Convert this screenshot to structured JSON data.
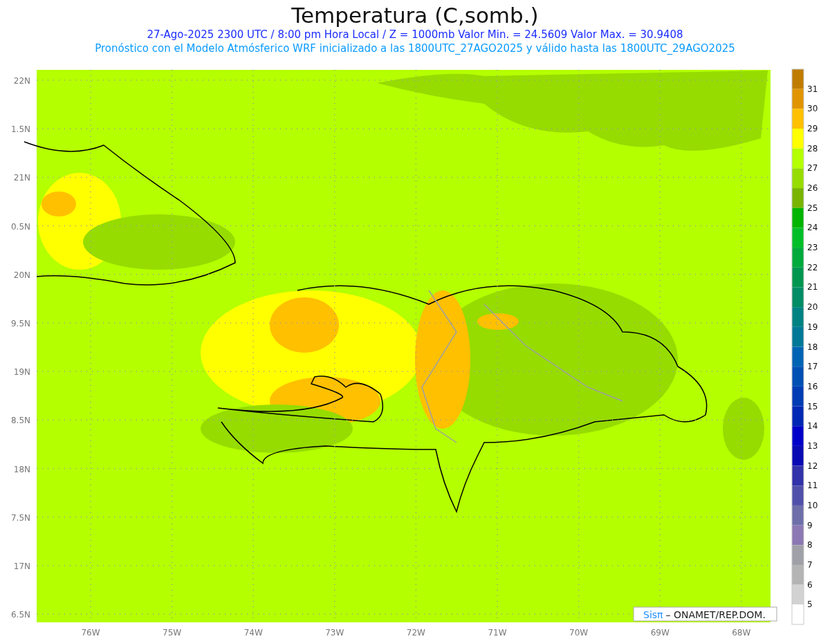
{
  "title": "Temperatura (C,somb.)",
  "subtitle": "27-Ago-2025  2300 UTC / 8:00 pm Hora Local / Z = 1000mb   Valor Min. = 24.5609  Valor Max. = 30.9408",
  "forecast_note": "Pronóstico con el Modelo Atmósferico WRF inicializado a las 1800UTC_27AGO2025 y válido hasta las  1800UTC_29AGO2025",
  "y_ticks": [
    "22N",
    "1.5N",
    "21N",
    "0.5N",
    "20N",
    "9.5N",
    "19N",
    "8.5N",
    "18N",
    "7.5N",
    "17N",
    "6.5N"
  ],
  "x_ticks": [
    "76W",
    "75W",
    "74W",
    "73W",
    "72W",
    "71W",
    "70W",
    "69W",
    "68W"
  ],
  "colorbar": {
    "segments": [
      {
        "color": "#c07c00"
      },
      {
        "color": "#e09400"
      },
      {
        "color": "#ffc000"
      },
      {
        "color": "#ffff00"
      },
      {
        "color": "#b4ff00"
      },
      {
        "color": "#96dc00"
      },
      {
        "color": "#78b400"
      },
      {
        "color": "#00b400"
      },
      {
        "color": "#00be28"
      },
      {
        "color": "#00aa3c"
      },
      {
        "color": "#009650"
      },
      {
        "color": "#008c64"
      },
      {
        "color": "#008282"
      },
      {
        "color": "#007896"
      },
      {
        "color": "#0064b4"
      },
      {
        "color": "#0050b4"
      },
      {
        "color": "#003cb4"
      },
      {
        "color": "#0028b4"
      },
      {
        "color": "#0000c8"
      },
      {
        "color": "#0a0ab4"
      },
      {
        "color": "#3232aa"
      },
      {
        "color": "#5050aa"
      },
      {
        "color": "#6e6eaa"
      },
      {
        "color": "#8c78b4"
      },
      {
        "color": "#a0a0a8"
      },
      {
        "color": "#b4b4b4"
      },
      {
        "color": "#d2d2d2"
      },
      {
        "color": "#ffffff"
      }
    ],
    "labels": [
      "31",
      "30",
      "29",
      "28",
      "27",
      "26",
      "25",
      "24",
      "23",
      "22",
      "21",
      "20",
      "19",
      "18",
      "17",
      "16",
      "15",
      "14",
      "13",
      "12",
      "11",
      "10",
      "9",
      "8",
      "7",
      "6",
      "5"
    ]
  },
  "credit": {
    "brand": "Sisπ",
    "text": "– ONAMET/REP.DOM."
  }
}
